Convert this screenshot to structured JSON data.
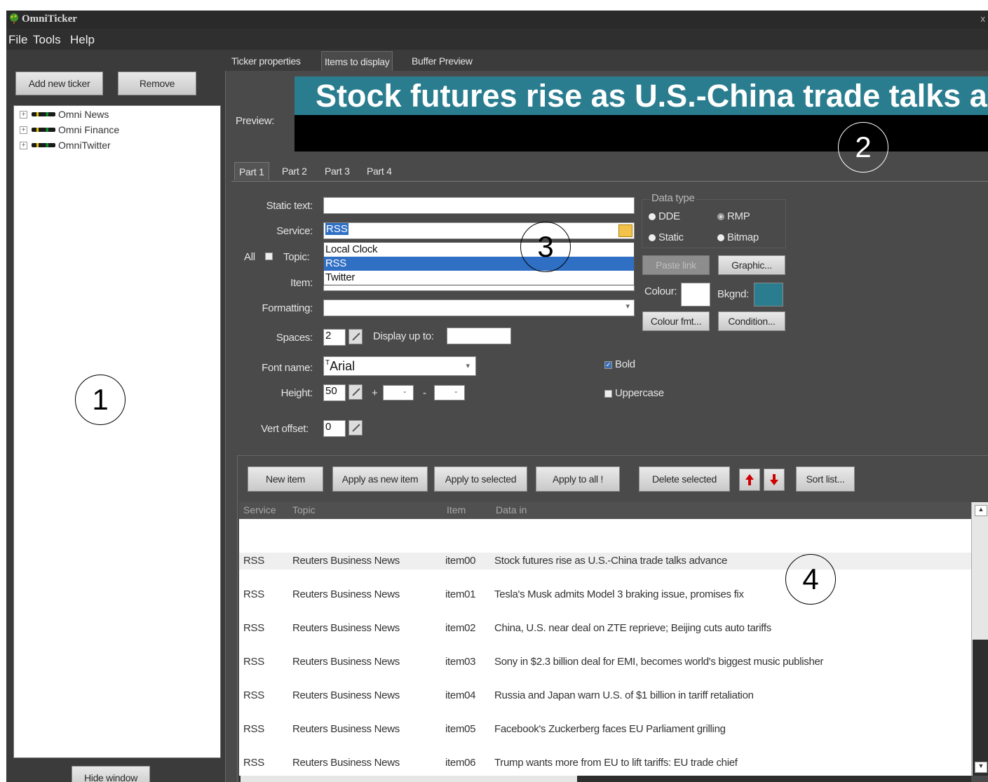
{
  "app": {
    "title": "OmniTicker",
    "close_glyph": "x"
  },
  "menu": [
    "File",
    "Tools",
    "Help"
  ],
  "left": {
    "add_button": "Add new ticker",
    "remove_button": "Remove",
    "tree": [
      "Omni News",
      "Omni Finance",
      "OmniTwitter"
    ],
    "hide_button": "Hide window"
  },
  "tabs": [
    "Ticker properties",
    "Items to display",
    "Buffer Preview"
  ],
  "preview": {
    "label": "Preview:",
    "text": "Stock futures rise as U.S.-China trade talks advance",
    "band_color": "#2a7d8f"
  },
  "parts": [
    "Part 1",
    "Part 2",
    "Part 3",
    "Part 4"
  ],
  "form": {
    "static_text_label": "Static text:",
    "static_text_value": "",
    "service_label": "Service:",
    "service_value": "RSS",
    "service_options": [
      "Local Clock",
      "RSS",
      "Twitter"
    ],
    "all_label": "All",
    "topic_label": "Topic:",
    "item_label": "Item:",
    "formatting_label": "Formatting:",
    "spaces_label": "Spaces:",
    "spaces_value": "2",
    "display_up_to_label": "Display up to:",
    "font_name_label": "Font name:",
    "font_name_value": "Arial",
    "font_prefix": "T",
    "height_label": "Height:",
    "height_value": "50",
    "plus_sign": "+",
    "minus_sign": "-",
    "vert_offset_label": "Vert offset:",
    "vert_offset_value": "0",
    "bold_label": "Bold",
    "bold_checked": true,
    "uppercase_label": "Uppercase",
    "uppercase_checked": false
  },
  "data_type": {
    "title": "Data type",
    "options": [
      "DDE",
      "RMP",
      "Static",
      "Bitmap"
    ],
    "selected": "RMP"
  },
  "side_buttons": {
    "paste_link": "Paste link",
    "graphic": "Graphic...",
    "colour_label": "Colour:",
    "bkgnd_label": "Bkgnd:",
    "colour_fmt": "Colour fmt...",
    "condition": "Condition...",
    "colour_value": "#ffffff",
    "bkgnd_value": "#2a7d8f"
  },
  "list_buttons": [
    "New item",
    "Apply as new item",
    "Apply to selected",
    "Apply to all !",
    "Delete selected",
    "Sort list..."
  ],
  "list": {
    "columns": [
      "Service",
      "Topic",
      "Item",
      "Data in"
    ],
    "rows": [
      [
        "RSS",
        "Reuters Business News",
        "item00",
        "Stock futures rise as U.S.-China trade talks advance"
      ],
      [
        "RSS",
        "Reuters Business News",
        "item01",
        "Tesla's Musk admits Model 3 braking issue, promises fix"
      ],
      [
        "RSS",
        "Reuters Business News",
        "item02",
        "China, U.S. near deal on ZTE reprieve; Beijing cuts auto tariffs"
      ],
      [
        "RSS",
        "Reuters Business News",
        "item03",
        "Sony in $2.3 billion deal for EMI, becomes world's biggest music publisher"
      ],
      [
        "RSS",
        "Reuters Business News",
        "item04",
        "Russia and Japan warn U.S. of $1 billion in tariff retaliation"
      ],
      [
        "RSS",
        "Reuters Business News",
        "item05",
        "Facebook's Zuckerberg faces EU Parliament grilling"
      ],
      [
        "RSS",
        "Reuters Business News",
        "item06",
        "Trump wants more from EU to lift tariffs: EU trade chief"
      ]
    ]
  },
  "markers": [
    "1",
    "2",
    "3",
    "4"
  ]
}
